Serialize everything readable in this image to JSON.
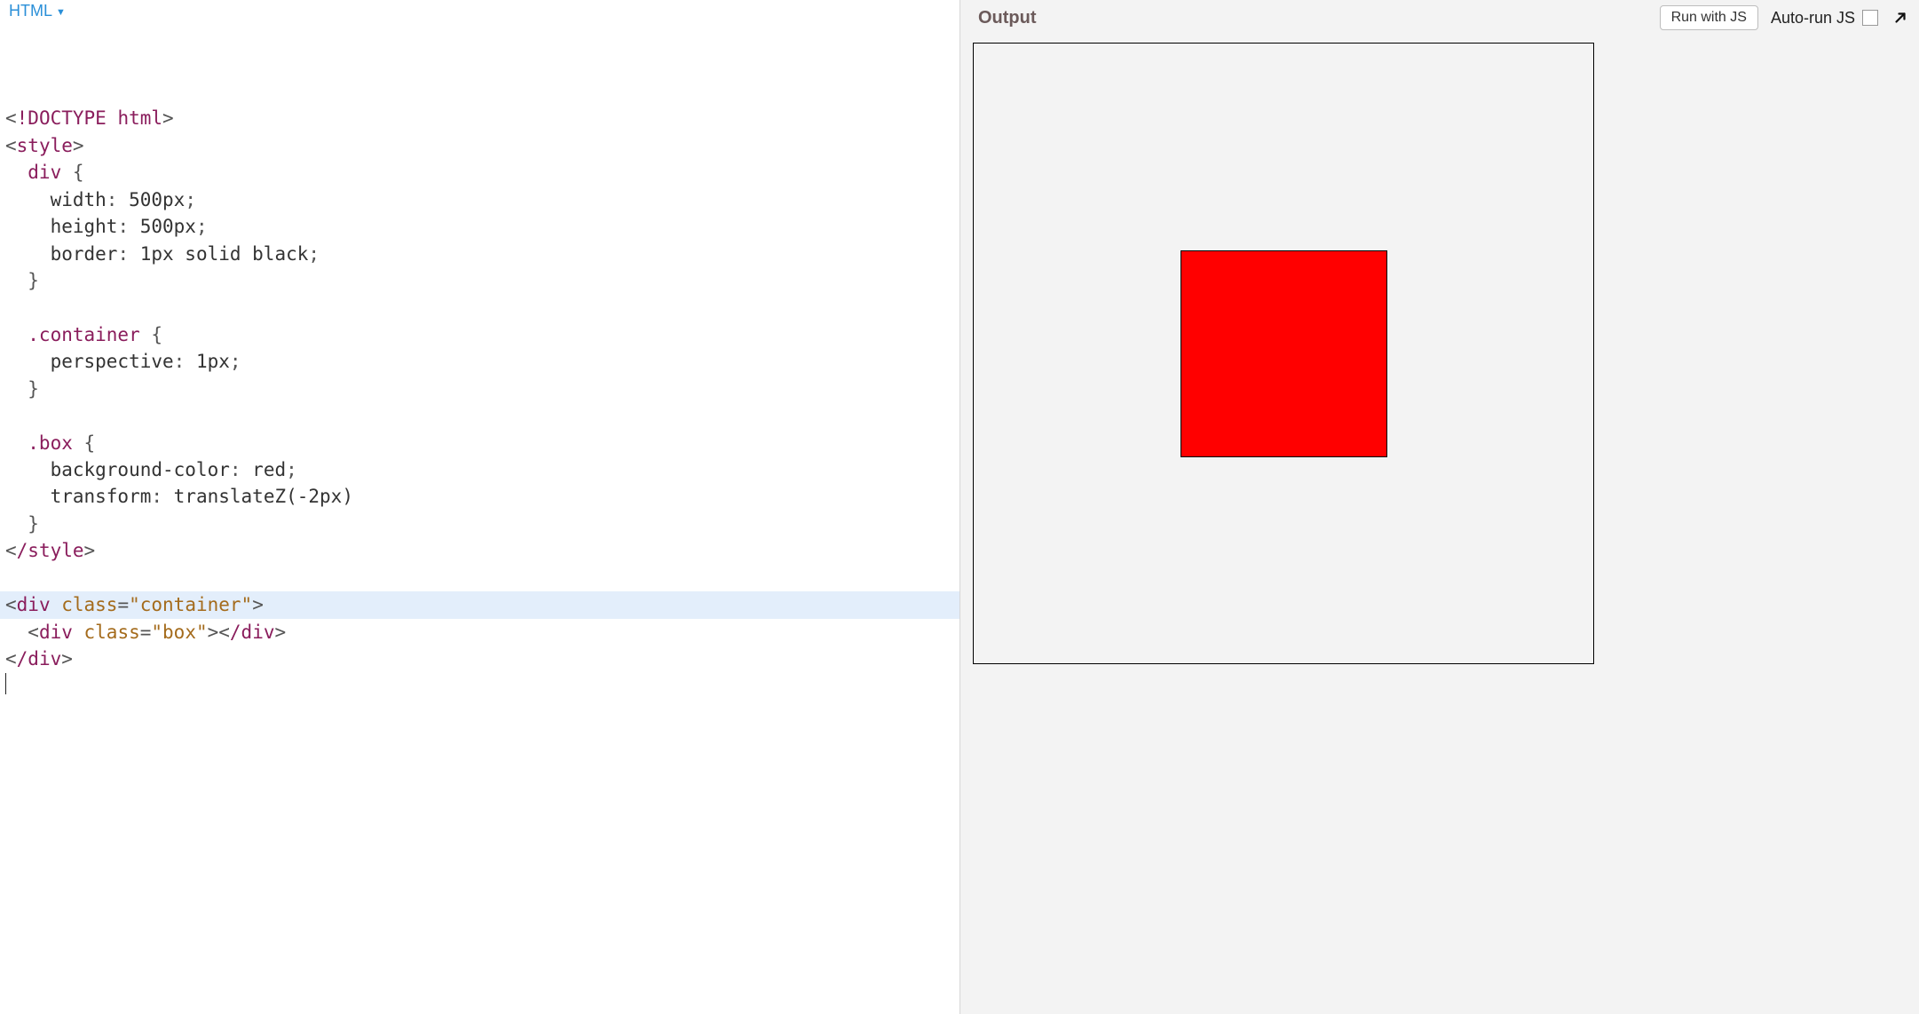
{
  "editor": {
    "language_label": "HTML",
    "code_lines": [
      {
        "type": "line",
        "parts": [
          [
            "<",
            "punct"
          ],
          [
            "!DOCTYPE html",
            "tag"
          ],
          [
            ">",
            "punct"
          ]
        ]
      },
      {
        "type": "line",
        "parts": [
          [
            "<",
            "punct"
          ],
          [
            "style",
            "tag"
          ],
          [
            ">",
            "punct"
          ]
        ]
      },
      {
        "type": "line",
        "parts": [
          [
            "  div ",
            "sel"
          ],
          [
            "{",
            "brace"
          ]
        ]
      },
      {
        "type": "line",
        "parts": [
          [
            "    width",
            "prop"
          ],
          [
            ": ",
            "punct"
          ],
          [
            "500px",
            "val"
          ],
          [
            ";",
            "punct"
          ]
        ]
      },
      {
        "type": "line",
        "parts": [
          [
            "    height",
            "prop"
          ],
          [
            ": ",
            "punct"
          ],
          [
            "500px",
            "val"
          ],
          [
            ";",
            "punct"
          ]
        ]
      },
      {
        "type": "line",
        "parts": [
          [
            "    border",
            "prop"
          ],
          [
            ": ",
            "punct"
          ],
          [
            "1px solid black",
            "val"
          ],
          [
            ";",
            "punct"
          ]
        ]
      },
      {
        "type": "line",
        "parts": [
          [
            "  }",
            "brace"
          ]
        ]
      },
      {
        "type": "line",
        "parts": [
          [
            "",
            ""
          ]
        ]
      },
      {
        "type": "line",
        "parts": [
          [
            "  .container ",
            "sel"
          ],
          [
            "{",
            "brace"
          ]
        ]
      },
      {
        "type": "line",
        "parts": [
          [
            "    perspective",
            "prop"
          ],
          [
            ": ",
            "punct"
          ],
          [
            "1px",
            "val"
          ],
          [
            ";",
            "punct"
          ]
        ]
      },
      {
        "type": "line",
        "parts": [
          [
            "  }",
            "brace"
          ]
        ]
      },
      {
        "type": "line",
        "parts": [
          [
            "",
            ""
          ]
        ]
      },
      {
        "type": "line",
        "parts": [
          [
            "  .box ",
            "sel"
          ],
          [
            "{",
            "brace"
          ]
        ]
      },
      {
        "type": "line",
        "parts": [
          [
            "    background-color",
            "prop"
          ],
          [
            ": ",
            "punct"
          ],
          [
            "red",
            "valcol"
          ],
          [
            ";",
            "punct"
          ]
        ]
      },
      {
        "type": "line",
        "parts": [
          [
            "    transform",
            "prop"
          ],
          [
            ": ",
            "punct"
          ],
          [
            "translateZ(-2px)",
            "val"
          ]
        ]
      },
      {
        "type": "line",
        "parts": [
          [
            "  }",
            "brace"
          ]
        ]
      },
      {
        "type": "line",
        "parts": [
          [
            "<",
            "punct"
          ],
          [
            "/style",
            "tag"
          ],
          [
            ">",
            "punct"
          ]
        ]
      },
      {
        "type": "line",
        "parts": [
          [
            "",
            ""
          ]
        ]
      },
      {
        "type": "line",
        "parts": [
          [
            "<",
            "punct"
          ],
          [
            "div ",
            "tag"
          ],
          [
            "class",
            "attr"
          ],
          [
            "=",
            "punct"
          ],
          [
            "\"container\"",
            "string"
          ],
          [
            ">",
            "punct"
          ]
        ]
      },
      {
        "type": "line",
        "parts": [
          [
            "  <",
            "punct"
          ],
          [
            "div ",
            "tag"
          ],
          [
            "class",
            "attr"
          ],
          [
            "=",
            "punct"
          ],
          [
            "\"box\"",
            "string"
          ],
          [
            "><",
            "punct"
          ],
          [
            "/div",
            "tag"
          ],
          [
            ">",
            "punct"
          ]
        ]
      },
      {
        "type": "line",
        "parts": [
          [
            "<",
            "punct"
          ],
          [
            "/div",
            "tag"
          ],
          [
            ">",
            "punct"
          ]
        ]
      },
      {
        "type": "cursor",
        "parts": []
      }
    ]
  },
  "output": {
    "title": "Output",
    "run_button_label": "Run with JS",
    "autorun_label": "Auto-run JS",
    "autorun_checked": false
  }
}
